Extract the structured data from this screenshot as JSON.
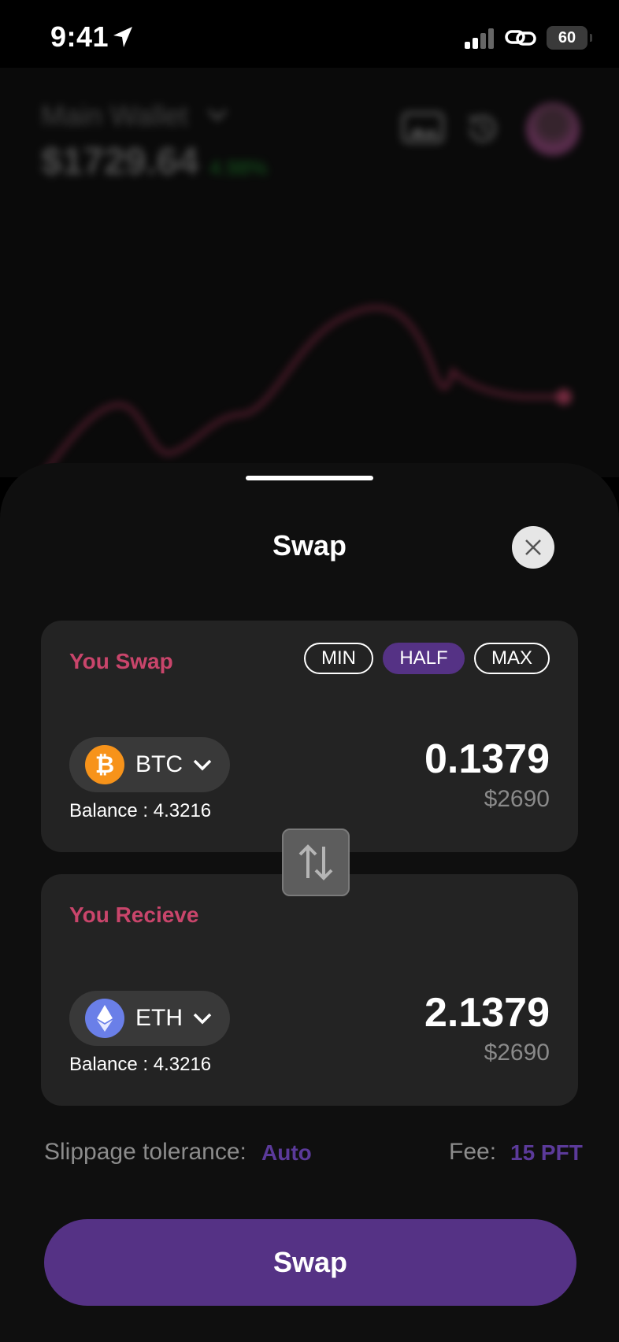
{
  "status_bar": {
    "time": "9:41",
    "battery": "60"
  },
  "background": {
    "wallet_name": "Main Wallet",
    "balance": "$1729.64",
    "change": "4.98%"
  },
  "sheet": {
    "title": "Swap",
    "from": {
      "label": "You Swap",
      "pills": {
        "min": "MIN",
        "half": "HALF",
        "max": "MAX"
      },
      "token": "BTC",
      "balance": "Balance : 4.3216",
      "amount": "0.1379",
      "amount_usd": "$2690"
    },
    "to": {
      "label": "You Recieve",
      "token": "ETH",
      "balance": "Balance : 4.3216",
      "amount": "2.1379",
      "amount_usd": "$2690"
    },
    "slippage_label": "Slippage tolerance:",
    "slippage_value": "Auto",
    "fee_label": "Fee:",
    "fee_value": "15 PFT",
    "swap_button": "Swap"
  },
  "colors": {
    "accent": "#553285",
    "label_pink": "#c9456b",
    "btc": "#f7931a",
    "eth": "#6a7fe8",
    "positive": "#1f9a2f"
  }
}
